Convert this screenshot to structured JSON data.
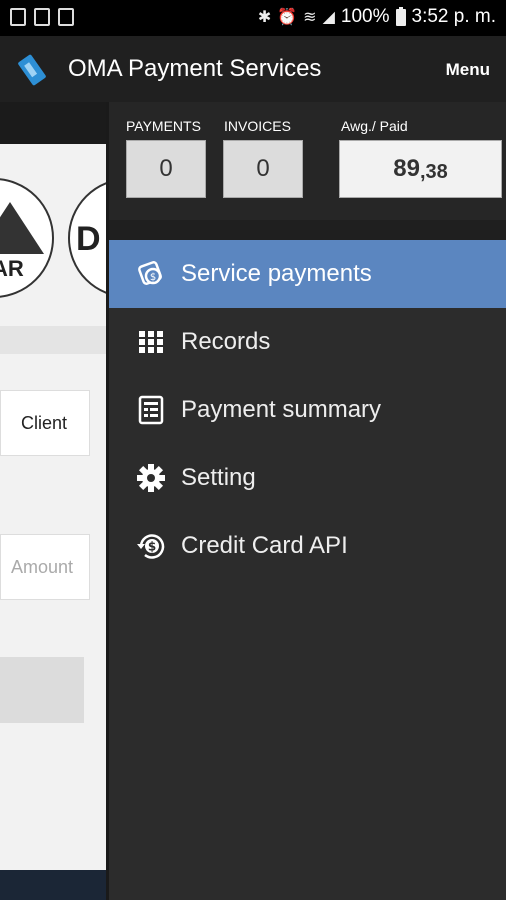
{
  "status_bar": {
    "battery": "100%",
    "time": "3:52 p. m."
  },
  "app_bar": {
    "title": "OMA Payment Services",
    "menu_label": "Menu"
  },
  "background": {
    "logo_text_1": "AR",
    "logo_text_2": "D",
    "client_label": "Client",
    "amount_placeholder": "Amount"
  },
  "drawer": {
    "stats": {
      "payments_label": "PAYMENTS",
      "payments_value": "0",
      "invoices_label": "INVOICES",
      "invoices_value": "0",
      "avg_label": "Awg./ Paid",
      "avg_int": "89",
      "avg_dec": ",38"
    },
    "items": [
      {
        "label": "Service payments",
        "icon": "service-payments-icon",
        "active": true
      },
      {
        "label": "Records",
        "icon": "grid-icon",
        "active": false
      },
      {
        "label": "Payment summary",
        "icon": "receipt-icon",
        "active": false
      },
      {
        "label": "Setting",
        "icon": "gear-icon",
        "active": false
      },
      {
        "label": "Credit Card API",
        "icon": "dollar-refresh-icon",
        "active": false
      }
    ]
  },
  "colors": {
    "active_item": "#5b86c0",
    "drawer_bg": "#2c2c2c",
    "appbar_bg": "#202020"
  }
}
